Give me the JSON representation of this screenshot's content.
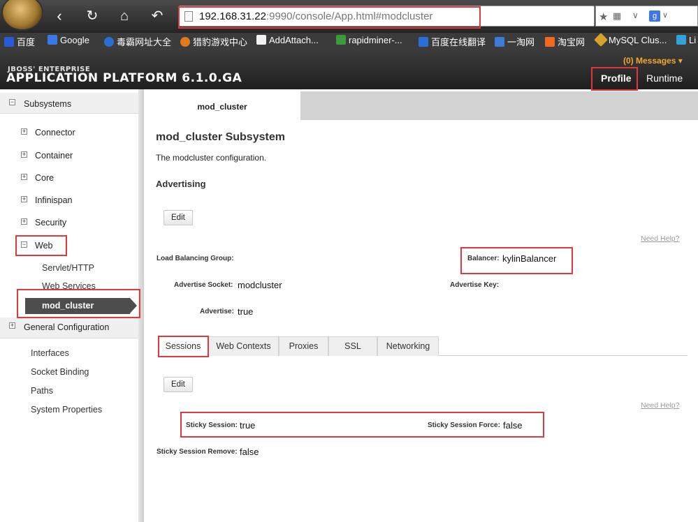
{
  "browser": {
    "url_host": "192.168.31.22",
    "url_rest": ":9990/console/App.html#modcluster",
    "bookmarks": [
      "百度",
      "Google",
      "毒霸网址大全",
      "猎豹游戏中心",
      "AddAttach...",
      "rapidminer-...",
      "百度在线翻译",
      "一淘网",
      "淘宝网",
      "MySQL Clus...",
      "Li"
    ]
  },
  "app": {
    "brand_top": "JBOSS' ENTERPRISE",
    "brand_bottom": "APPLICATION PLATFORM 6.1.0.GA",
    "messages": "(0) Messages ▾",
    "tabs": {
      "profile": "Profile",
      "runtime": "Runtime"
    }
  },
  "sidebar": {
    "subsystems": "Subsystems",
    "items": [
      "Connector",
      "Container",
      "Core",
      "Infinispan",
      "Security",
      "Web"
    ],
    "web_children": [
      "Servlet/HTTP",
      "Web Services",
      "mod_cluster"
    ],
    "general": "General Configuration",
    "general_items": [
      "Interfaces",
      "Socket Binding",
      "Paths",
      "System Properties"
    ]
  },
  "content": {
    "tab": "mod_cluster",
    "title": "mod_cluster Subsystem",
    "description": "The modcluster configuration.",
    "section": "Advertising",
    "edit": "Edit",
    "need_help": "Need Help?",
    "fields": {
      "lb_group_label": "Load Balancing Group:",
      "balancer_label": "Balancer:",
      "balancer_value": "kylinBalancer",
      "adv_socket_label": "Advertise Socket:",
      "adv_socket_value": "modcluster",
      "adv_key_label": "Advertise Key:",
      "advertise_label": "Advertise:",
      "advertise_value": "true"
    },
    "subtabs": [
      "Sessions",
      "Web Contexts",
      "Proxies",
      "SSL",
      "Networking"
    ],
    "sessions": {
      "sticky_label": "Sticky Session:",
      "sticky_value": "true",
      "force_label": "Sticky Session Force:",
      "force_value": "false",
      "remove_label": "Sticky Session Remove:",
      "remove_value": "false"
    }
  },
  "colors": {
    "highlight": "#e0383e",
    "messages": "#f3a82b",
    "selected_item": "#4d4d4d"
  }
}
